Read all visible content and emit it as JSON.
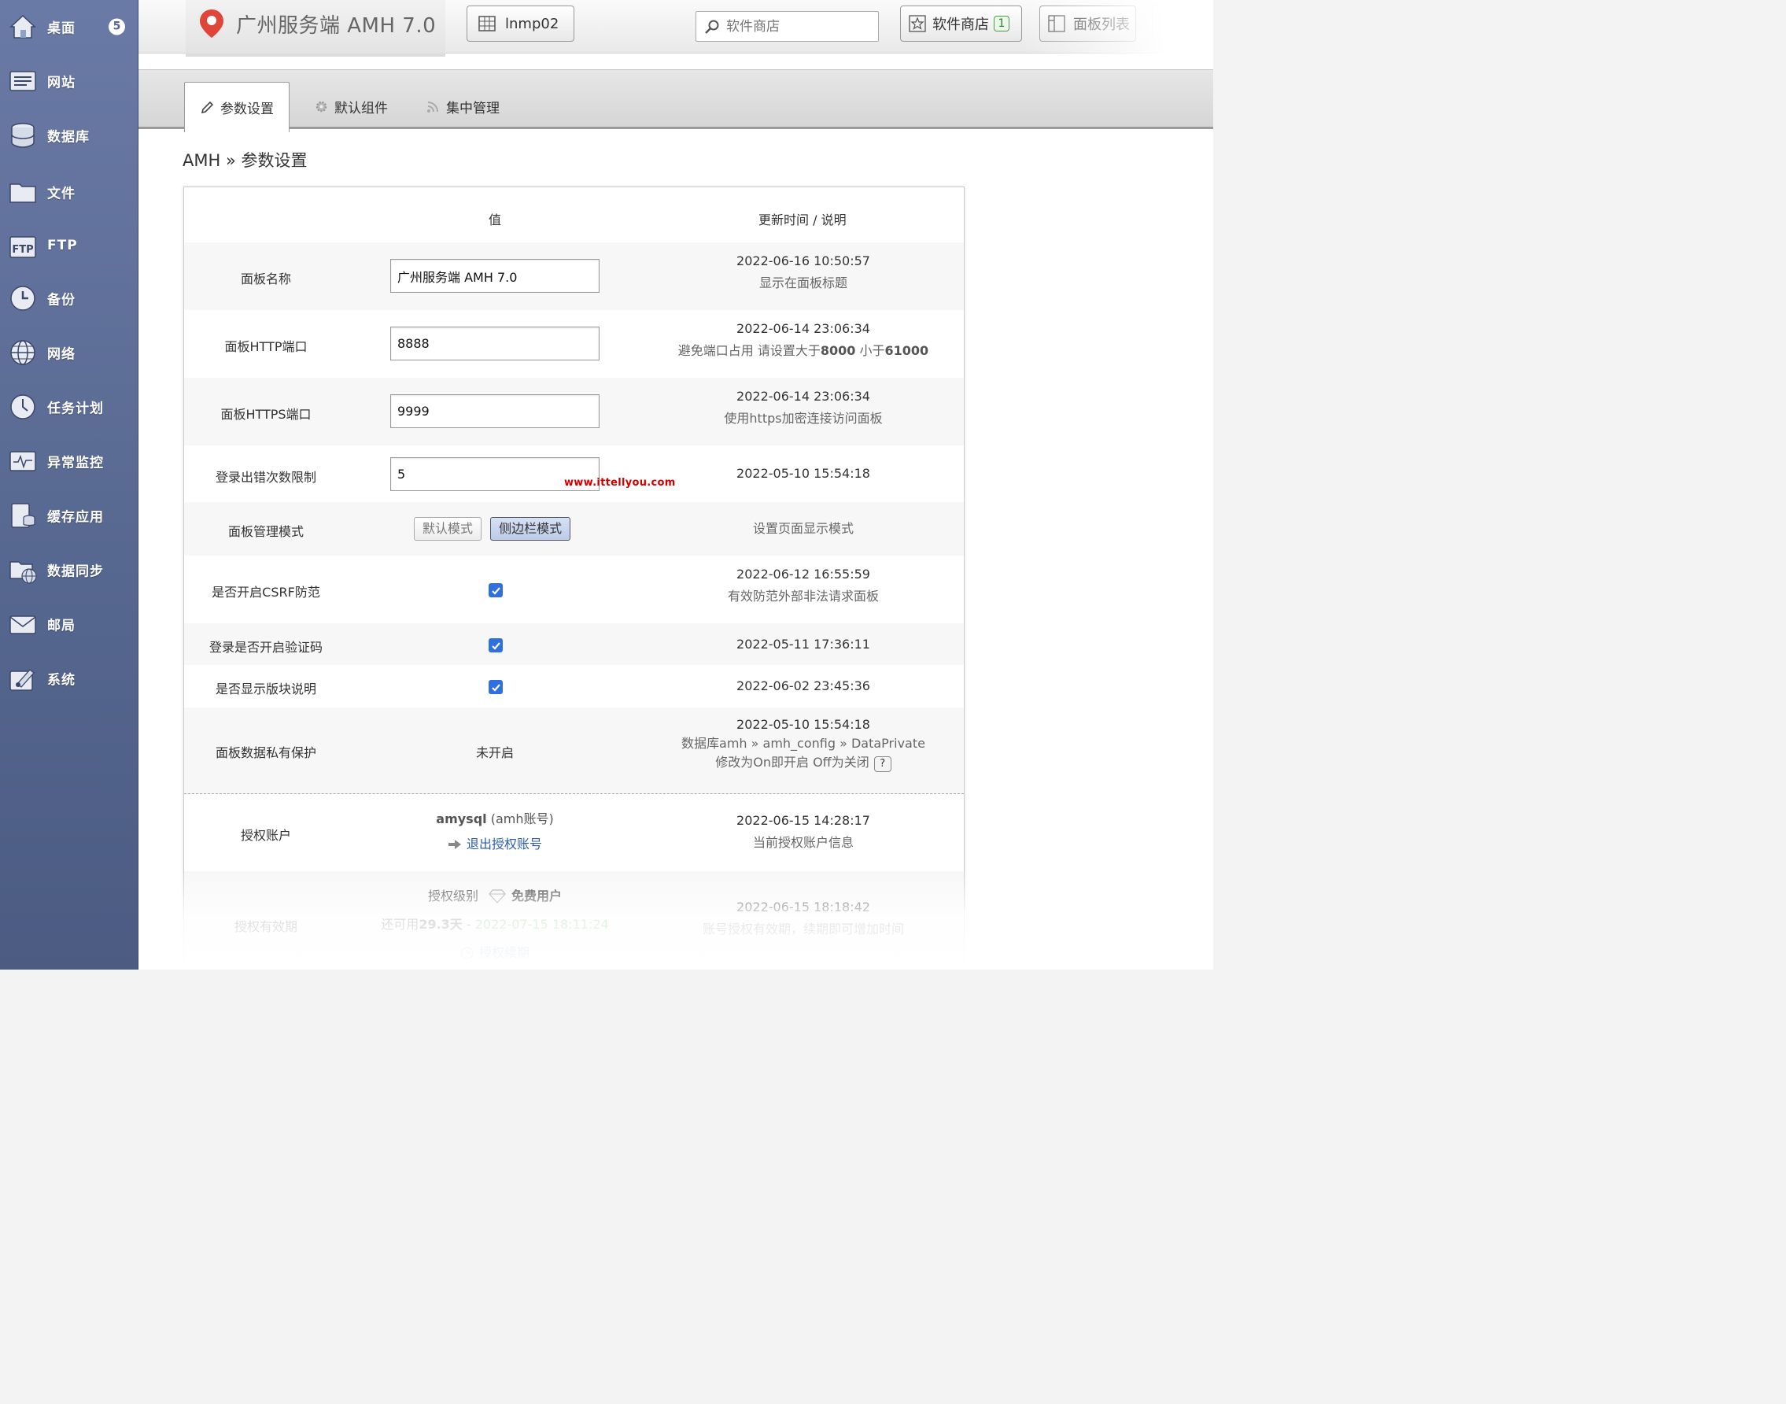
{
  "sidebar": {
    "items": [
      {
        "label": "桌面",
        "icon": "home-icon",
        "badge": "5"
      },
      {
        "label": "网站",
        "icon": "website-icon"
      },
      {
        "label": "数据库",
        "icon": "database-icon"
      },
      {
        "label": "文件",
        "icon": "folder-icon"
      },
      {
        "label": "FTP",
        "icon": "ftp-icon"
      },
      {
        "label": "备份",
        "icon": "backup-icon"
      },
      {
        "label": "网络",
        "icon": "globe-icon"
      },
      {
        "label": "任务计划",
        "icon": "clock-icon"
      },
      {
        "label": "异常监控",
        "icon": "monitor-icon"
      },
      {
        "label": "缓存应用",
        "icon": "cache-icon"
      },
      {
        "label": "数据同步",
        "icon": "sync-icon"
      },
      {
        "label": "邮局",
        "icon": "mail-icon"
      },
      {
        "label": "系统",
        "icon": "system-icon"
      }
    ]
  },
  "header": {
    "brand_title": "广州服务端 AMH 7.0",
    "env_button": "lnmp02",
    "search_placeholder": "软件商店",
    "store_button": "软件商店",
    "store_badge": "1",
    "panel_list_button": "面板列表"
  },
  "tabs": [
    {
      "label": "参数设置",
      "icon": "pencil-icon",
      "active": true
    },
    {
      "label": "默认组件",
      "icon": "gear-icon",
      "active": false
    },
    {
      "label": "集中管理",
      "icon": "rss-icon",
      "active": false
    }
  ],
  "breadcrumb": "AMH » 参数设置",
  "table": {
    "col_value": "值",
    "col_desc": "更新时间 / 说明",
    "rows": {
      "panel_name": {
        "label": "面板名称",
        "value": "广州服务端 AMH 7.0",
        "time": "2022-06-16 10:50:57",
        "note": "显示在面板标题"
      },
      "http_port": {
        "label": "面板HTTP端口",
        "value": "8888",
        "time": "2022-06-14 23:06:34",
        "note_pre": "避免端口占用 请设置大于",
        "note_min": "8000",
        "note_mid": " 小于",
        "note_max": "61000"
      },
      "https_port": {
        "label": "面板HTTPS端口",
        "value": "9999",
        "time": "2022-06-14 23:06:34",
        "note": "使用https加密连接访问面板"
      },
      "login_limit": {
        "label": "登录出错次数限制",
        "value": "5",
        "time": "2022-05-10 15:54:18"
      },
      "panel_mode": {
        "label": "面板管理模式",
        "option_default": "默认模式",
        "option_sidebar": "侧边栏模式",
        "selected": "侧边栏模式",
        "note": "设置页面显示模式"
      },
      "csrf": {
        "label": "是否开启CSRF防范",
        "checked": true,
        "time": "2022-06-12 16:55:59",
        "note": "有效防范外部非法请求面板"
      },
      "captcha": {
        "label": "登录是否开启验证码",
        "checked": true,
        "time": "2022-05-11 17:36:11"
      },
      "show_desc": {
        "label": "是否显示版块说明",
        "checked": true,
        "time": "2022-06-02 23:45:36"
      },
      "data_private": {
        "label": "面板数据私有保护",
        "value": "未开启",
        "time": "2022-05-10 15:54:18",
        "note_line1": "数据库amh » amh_config » DataPrivate",
        "note_line2": "修改为On即开启 Off为关闭",
        "help": "?"
      },
      "auth_account": {
        "label": "授权账户",
        "account": "amysql",
        "account_suffix": " (amh账号)",
        "logout_link": "退出授权账号",
        "time": "2022-06-15 14:28:17",
        "note": "当前授权账户信息"
      },
      "auth_valid": {
        "label": "授权有效期",
        "level_label": "授权级别",
        "level_value": "免费用户",
        "remain_pre": "还可用",
        "remain_days": "29.3天",
        "remain_sep": " - ",
        "expire": "2022-07-15 18:11:24",
        "renew_link": "授权续期",
        "time": "2022-06-15 18:18:42",
        "note": "账号授权有效期，续期即可增加时间"
      }
    }
  },
  "watermark": "www.ittellyou.com",
  "colors": {
    "sidebar": "#5b6b94",
    "accent_blue": "#2f6fe0",
    "link_blue": "#2a5db0",
    "expire_green": "#4caf50",
    "watermark_red": "#d40000"
  }
}
